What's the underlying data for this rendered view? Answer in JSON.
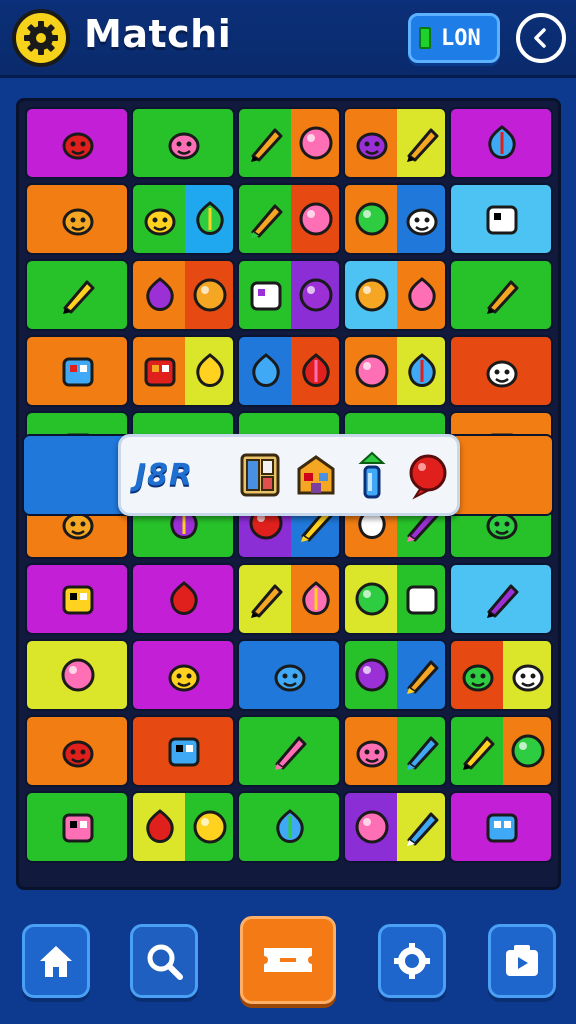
{
  "app": {
    "title": "Matchi",
    "status_label": "LON",
    "status_color": "#1fd12c",
    "accent": "#1f7de8",
    "logo_icon": "gear-icon",
    "back_icon": "chevron-left-icon"
  },
  "match_bar": {
    "code": "J8R",
    "slots": [
      "cabinet-icon",
      "house-box-icon",
      "bottle-icon",
      "red-ball-icon"
    ]
  },
  "board": {
    "columns": 5,
    "rows": [
      [
        {
          "colors": [
            "#c21fd6"
          ],
          "icon": "leaf-icon"
        },
        {
          "colors": [
            "#27c22a"
          ],
          "icon": "star-badge-icon"
        },
        {
          "colors": [
            "#27c22a",
            "#f27d12"
          ],
          "icon": "heart-bottle-icon"
        },
        {
          "colors": [
            "#f27d12",
            "#dbe62a"
          ],
          "icon": "face-celery-icon"
        },
        {
          "colors": [
            "#c21fd6"
          ],
          "icon": "carrot-icon"
        }
      ],
      [
        {
          "colors": [
            "#f27d12"
          ],
          "icon": "flower-critter-icon"
        },
        {
          "colors": [
            "#27c22a",
            "#1fa8f0"
          ],
          "icon": "smiley-icon"
        },
        {
          "colors": [
            "#27c22a",
            "#e64a12"
          ],
          "icon": "orange-fruit-icon"
        },
        {
          "colors": [
            "#f27d12",
            "#1f78da"
          ],
          "icon": "question-box-icon"
        },
        {
          "colors": [
            "#4cc3f2"
          ],
          "icon": "cheese-icon"
        }
      ],
      [
        {
          "colors": [
            "#27c22a"
          ],
          "icon": "onion-icon"
        },
        {
          "colors": [
            "#f27d12",
            "#e64a12"
          ],
          "icon": "robot-icon"
        },
        {
          "colors": [
            "#27c22a",
            "#8b2ed6"
          ],
          "icon": "pencil-key-icon"
        },
        {
          "colors": [
            "#4cc3f2",
            "#f27d12"
          ],
          "icon": "camera-icon"
        },
        {
          "colors": [
            "#27c22a"
          ],
          "icon": "treasure-box-icon"
        }
      ],
      [
        {
          "colors": [
            "#f27d12"
          ],
          "icon": "piano-ball-icon"
        },
        {
          "colors": [
            "#f27d12",
            "#dbe62a"
          ],
          "icon": "red-pepper-icon"
        },
        {
          "colors": [
            "#1f78da",
            "#e64a12"
          ],
          "icon": "purple-marker-icon"
        },
        {
          "colors": [
            "#f27d12",
            "#dbe62a"
          ],
          "icon": "flower-bottle-icon"
        },
        {
          "colors": [
            "#e64a12"
          ],
          "icon": "lollipop-sign-icon"
        }
      ],
      [
        {
          "colors": [
            "#27c22a"
          ],
          "icon": "green-marker-icon"
        },
        {
          "colors": [
            "#27c22a"
          ],
          "icon": "blank-icon"
        },
        {
          "colors": [
            "#27c22a"
          ],
          "icon": "blank-icon"
        },
        {
          "colors": [
            "#27c22a"
          ],
          "icon": "blank-icon"
        },
        {
          "colors": [
            "#f27d12"
          ],
          "icon": "green-apple-icon"
        }
      ],
      [
        {
          "colors": [
            "#f27d12"
          ],
          "icon": "herb-icon"
        },
        {
          "colors": [
            "#27c22a"
          ],
          "icon": "brush-icon"
        },
        {
          "colors": [
            "#8b2ed6",
            "#1f78da"
          ],
          "icon": "egg-sparkle-icon"
        },
        {
          "colors": [
            "#f27d12",
            "#27c22a"
          ],
          "icon": "green-blob-icon"
        },
        {
          "colors": [
            "#27c22a"
          ],
          "icon": "purple-lollipop-icon"
        }
      ],
      [
        {
          "colors": [
            "#c21fd6"
          ],
          "icon": "radish-icon"
        },
        {
          "colors": [
            "#c21fd6"
          ],
          "icon": "tablet-icon"
        },
        {
          "colors": [
            "#dbe62a",
            "#f27d12"
          ],
          "icon": "bell-hook-icon"
        },
        {
          "colors": [
            "#dbe62a",
            "#27c22a"
          ],
          "icon": "turtle-icon"
        },
        {
          "colors": [
            "#4cc3f2"
          ],
          "icon": "purple-box-icon"
        }
      ],
      [
        {
          "colors": [
            "#dbe62a"
          ],
          "icon": "orange-mic-icon"
        },
        {
          "colors": [
            "#c21fd6"
          ],
          "icon": "dice-critter-icon"
        },
        {
          "colors": [
            "#1f78da"
          ],
          "icon": "flame-icon"
        },
        {
          "colors": [
            "#27c22a",
            "#1f78da"
          ],
          "icon": "arrow-sparkle-icon"
        },
        {
          "colors": [
            "#e64a12",
            "#dbe62a"
          ],
          "icon": "leaf-badge-icon"
        }
      ],
      [
        {
          "colors": [
            "#f27d12"
          ],
          "icon": "red-marker-icon"
        },
        {
          "colors": [
            "#e64a12"
          ],
          "icon": "white-ball-icon"
        },
        {
          "colors": [
            "#27c22a"
          ],
          "icon": "blue-blob-icon"
        },
        {
          "colors": [
            "#f27d12",
            "#27c22a"
          ],
          "icon": "pin-cabinet-icon"
        },
        {
          "colors": [
            "#27c22a",
            "#f27d12"
          ],
          "icon": "s-badge-icon"
        }
      ],
      [
        {
          "colors": [
            "#27c22a"
          ],
          "icon": "card-icon"
        },
        {
          "colors": [
            "#dbe62a",
            "#27c22a"
          ],
          "icon": "green-ball-splat-icon"
        },
        {
          "colors": [
            "#27c22a"
          ],
          "icon": "yellow-marker-icon"
        },
        {
          "colors": [
            "#8b2ed6",
            "#dbe62a"
          ],
          "icon": "pin-x-icon"
        },
        {
          "colors": [
            "#c21fd6"
          ],
          "icon": "red-critter-icon"
        }
      ]
    ]
  },
  "nav": [
    {
      "icon": "home-icon"
    },
    {
      "icon": "search-icon"
    },
    {
      "icon": "ticket-icon"
    },
    {
      "icon": "settings-badge-icon"
    },
    {
      "icon": "camera-box-icon"
    }
  ]
}
